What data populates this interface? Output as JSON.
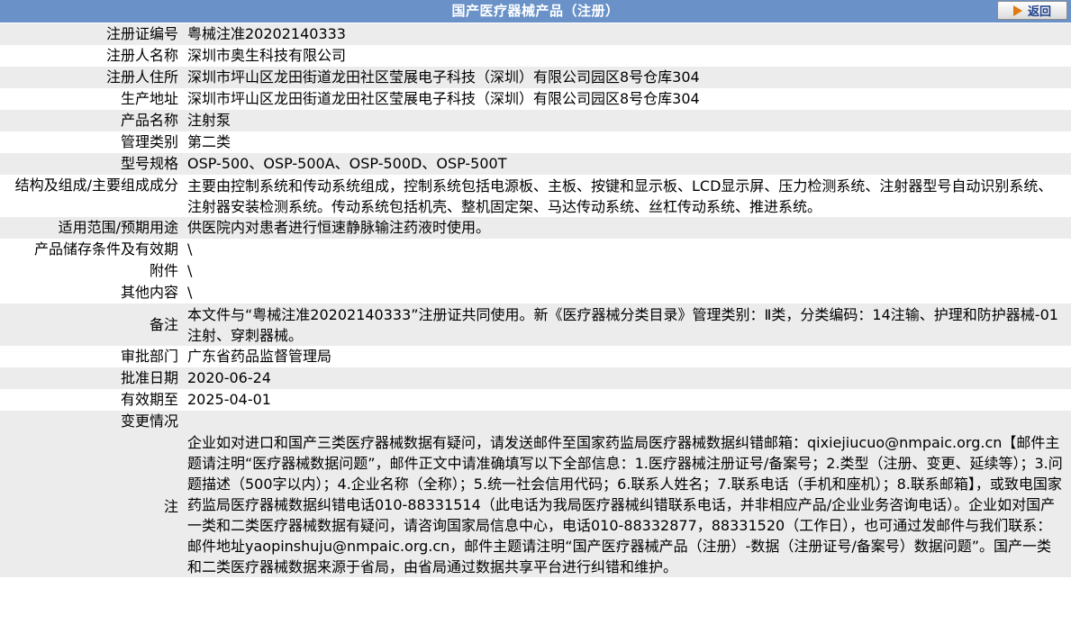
{
  "header": {
    "title": "国产医疗器械产品（注册）",
    "back_label": "返回"
  },
  "rows": [
    {
      "label": "注册证编号",
      "value": "粤械注准20202140333"
    },
    {
      "label": "注册人名称",
      "value": "深圳市奥生科技有限公司"
    },
    {
      "label": "注册人住所",
      "value": "深圳市坪山区龙田街道龙田社区莹展电子科技（深圳）有限公司园区8号仓库304"
    },
    {
      "label": "生产地址",
      "value": "深圳市坪山区龙田街道龙田社区莹展电子科技（深圳）有限公司园区8号仓库304"
    },
    {
      "label": "产品名称",
      "value": "注射泵"
    },
    {
      "label": "管理类别",
      "value": "第二类"
    },
    {
      "label": "型号规格",
      "value": "OSP-500、OSP-500A、OSP-500D、OSP-500T"
    },
    {
      "label": "结构及组成/主要组成成分",
      "value": "主要由控制系统和传动系统组成，控制系统包括电源板、主板、按键和显示板、LCD显示屏、压力检测系统、注射器型号自动识别系统、注射器安装检测系统。传动系统包括机壳、整机固定架、马达传动系统、丝杠传动系统、推进系统。"
    },
    {
      "label": "适用范围/预期用途",
      "value": "供医院内对患者进行恒速静脉输注药液时使用。"
    },
    {
      "label": "产品储存条件及有效期",
      "value": "\\"
    },
    {
      "label": "附件",
      "value": "\\"
    },
    {
      "label": "其他内容",
      "value": "\\"
    },
    {
      "label": "备注",
      "value": "本文件与“粤械注准20202140333”注册证共同使用。新《医疗器械分类目录》管理类别：Ⅱ类，分类编码：14注输、护理和防护器械-01注射、穿刺器械。"
    },
    {
      "label": "审批部门",
      "value": "广东省药品监督管理局"
    },
    {
      "label": "批准日期",
      "value": "2020-06-24"
    },
    {
      "label": "有效期至",
      "value": "2025-04-01"
    },
    {
      "label": "变更情况",
      "value": ""
    }
  ],
  "note": {
    "label": "注",
    "text": "企业如对进口和国产三类医疗器械数据有疑问，请发送邮件至国家药监局医疗器械数据纠错邮箱：qixiejiucuo@nmpaic.org.cn【邮件主题请注明“医疗器械数据问题”，邮件正文中请准确填写以下全部信息：1.医疗器械注册证号/备案号；2.类型（注册、变更、延续等）；3.问题描述（500字以内）；4.企业名称（全称）；5.统一社会信用代码；6.联系人姓名；7.联系电话（手机和座机）；8.联系邮箱】，或致电国家药监局医疗器械数据纠错电话010-88331514（此电话为我局医疗器械纠错联系电话，并非相应产品/企业业务咨询电话）。企业如对国产一类和二类医疗器械数据有疑问，请咨询国家局信息中心，电话010-88332877，88331520（工作日），也可通过发邮件与我们联系：邮件地址yaopinshuju@nmpaic.org.cn，邮件主题请注明“国产医疗器械产品（注册）-数据（注册证号/备案号）数据问题”。国产一类和二类医疗器械数据来源于省局，由省局通过数据共享平台进行纠错和维护。"
  },
  "colors": {
    "header_bg": "#6a92c8",
    "row_gray": "#ececec",
    "row_white": "#ffffff",
    "back_text": "#1d3f8c",
    "back_arrow": "#e07a10"
  }
}
